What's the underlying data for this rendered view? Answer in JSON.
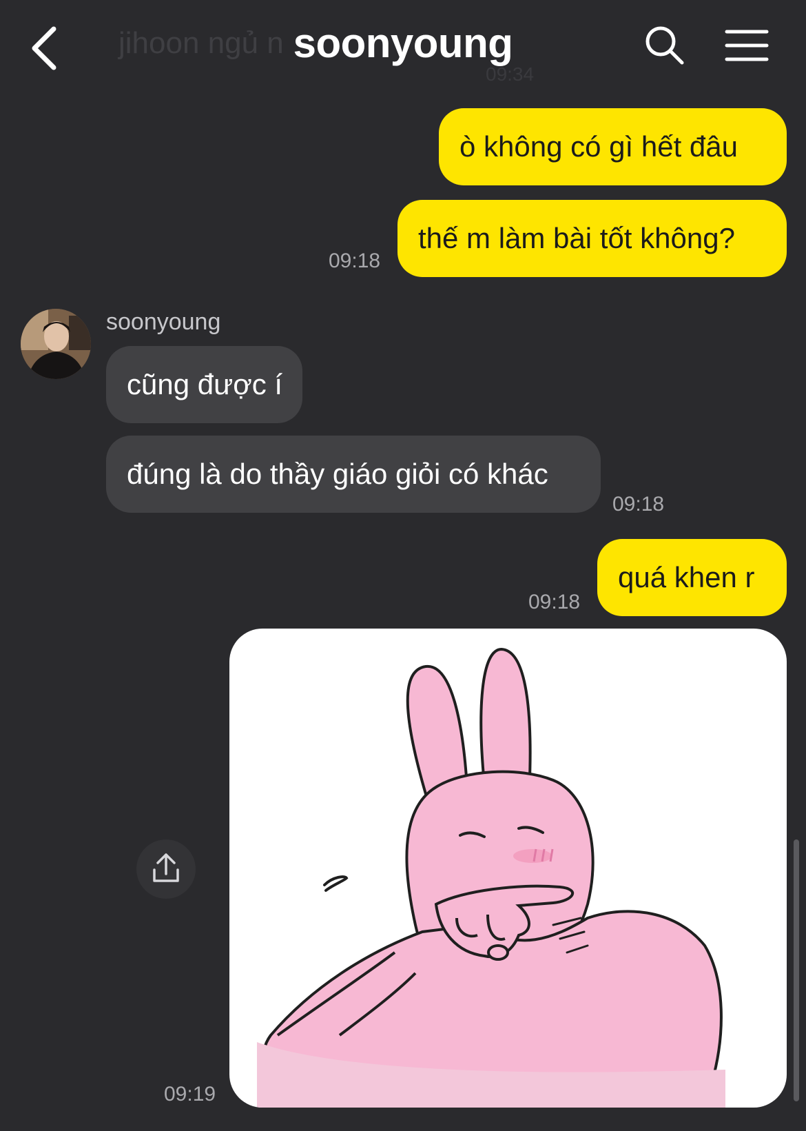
{
  "header": {
    "title": "soonyoung",
    "previous_preview": "jihoon ngủ n",
    "previous_time": "09:34",
    "back_icon": "chevron-left-icon",
    "search_icon": "search-icon",
    "menu_icon": "hamburger-menu-icon"
  },
  "colors": {
    "background": "#2a2a2d",
    "my_bubble": "#fee500",
    "their_bubble": "#414144",
    "timestamp": "#a9a9ad"
  },
  "messages": [
    {
      "from": "me",
      "text": "ò không có gì hết đâu",
      "time": ""
    },
    {
      "from": "me",
      "text": "thế m làm bài tốt không?",
      "time": "09:18"
    },
    {
      "from": "soonyoung",
      "text": "cũng được í",
      "time": ""
    },
    {
      "from": "soonyoung",
      "text": "đúng là do thầy giáo giỏi có khác",
      "time": "09:18"
    },
    {
      "from": "me",
      "text": "quá khen r",
      "time": "09:18"
    },
    {
      "from": "me",
      "type": "sticker",
      "sticker": "pink rabbit sticker",
      "time": "09:19"
    }
  ],
  "sender": {
    "name": "soonyoung"
  },
  "share_icon": "share-upload-icon"
}
